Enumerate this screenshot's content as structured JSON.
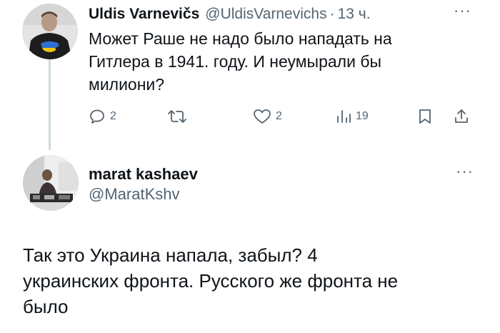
{
  "tweet1": {
    "author_name": "Uldis Varnevičs",
    "handle": "@UldisVarnevichs",
    "separator": "·",
    "time": "13 ч.",
    "more_icon": "more-horizontal-icon",
    "text": "Может Раше не надо было нападать на\nГитлера в 1941. году. И неумырали бы\nмилиони?",
    "actions": {
      "replies": "2",
      "retweets": "",
      "likes": "2",
      "views": "19"
    }
  },
  "tweet2": {
    "author_name": "marat kashaev",
    "handle": "@MaratKshv",
    "more_icon": "more-horizontal-icon",
    "text": "Так это Украина напала, забыл? 4\nукраинских фронта. Русского же фронта не\nбыло"
  },
  "colors": {
    "text_primary": "#0f1419",
    "text_secondary": "#536471",
    "thread_line": "#cfd9de"
  }
}
